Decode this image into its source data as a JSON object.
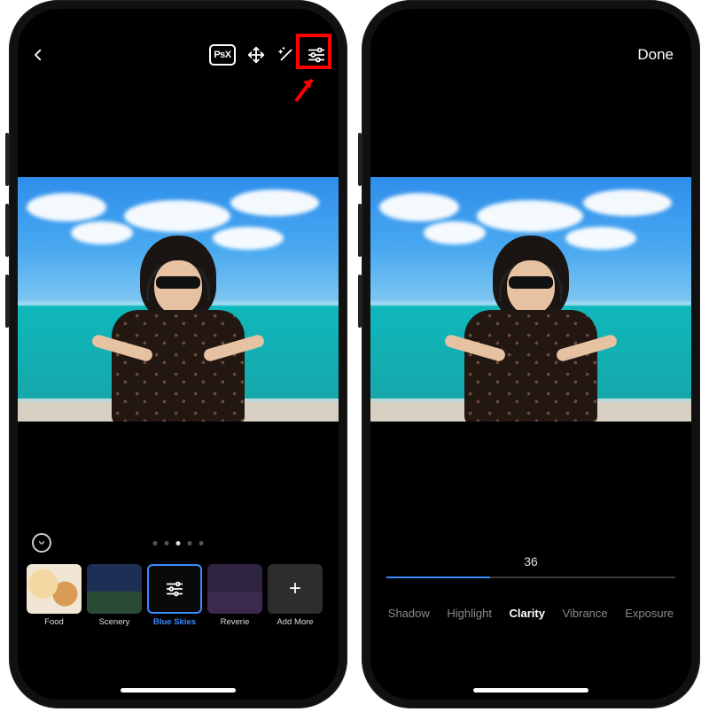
{
  "left": {
    "toolbar": {
      "back_icon": "chevron-left",
      "psx_label": "PsX",
      "move_icon": "move",
      "magic_icon": "magic-wand",
      "sliders_icon": "sliders",
      "highlighted": "sliders"
    },
    "pager": {
      "dot_count": 5,
      "active_index": 2
    },
    "filters": [
      {
        "label": "Food",
        "kind": "food",
        "selected": false
      },
      {
        "label": "Scenery",
        "kind": "scenery",
        "selected": false
      },
      {
        "label": "Blue Skies",
        "kind": "blueskies",
        "selected": true
      },
      {
        "label": "Reverie",
        "kind": "reverie",
        "selected": false
      },
      {
        "label": "Add More",
        "kind": "addmore",
        "selected": false
      }
    ]
  },
  "right": {
    "toolbar": {
      "done_label": "Done"
    },
    "slider": {
      "value": 36,
      "min": 0,
      "max": 100
    },
    "tabs": [
      {
        "label": "Shadow",
        "active": false
      },
      {
        "label": "Highlight",
        "active": false
      },
      {
        "label": "Clarity",
        "active": true
      },
      {
        "label": "Vibrance",
        "active": false
      },
      {
        "label": "Exposure",
        "active": false
      }
    ]
  }
}
